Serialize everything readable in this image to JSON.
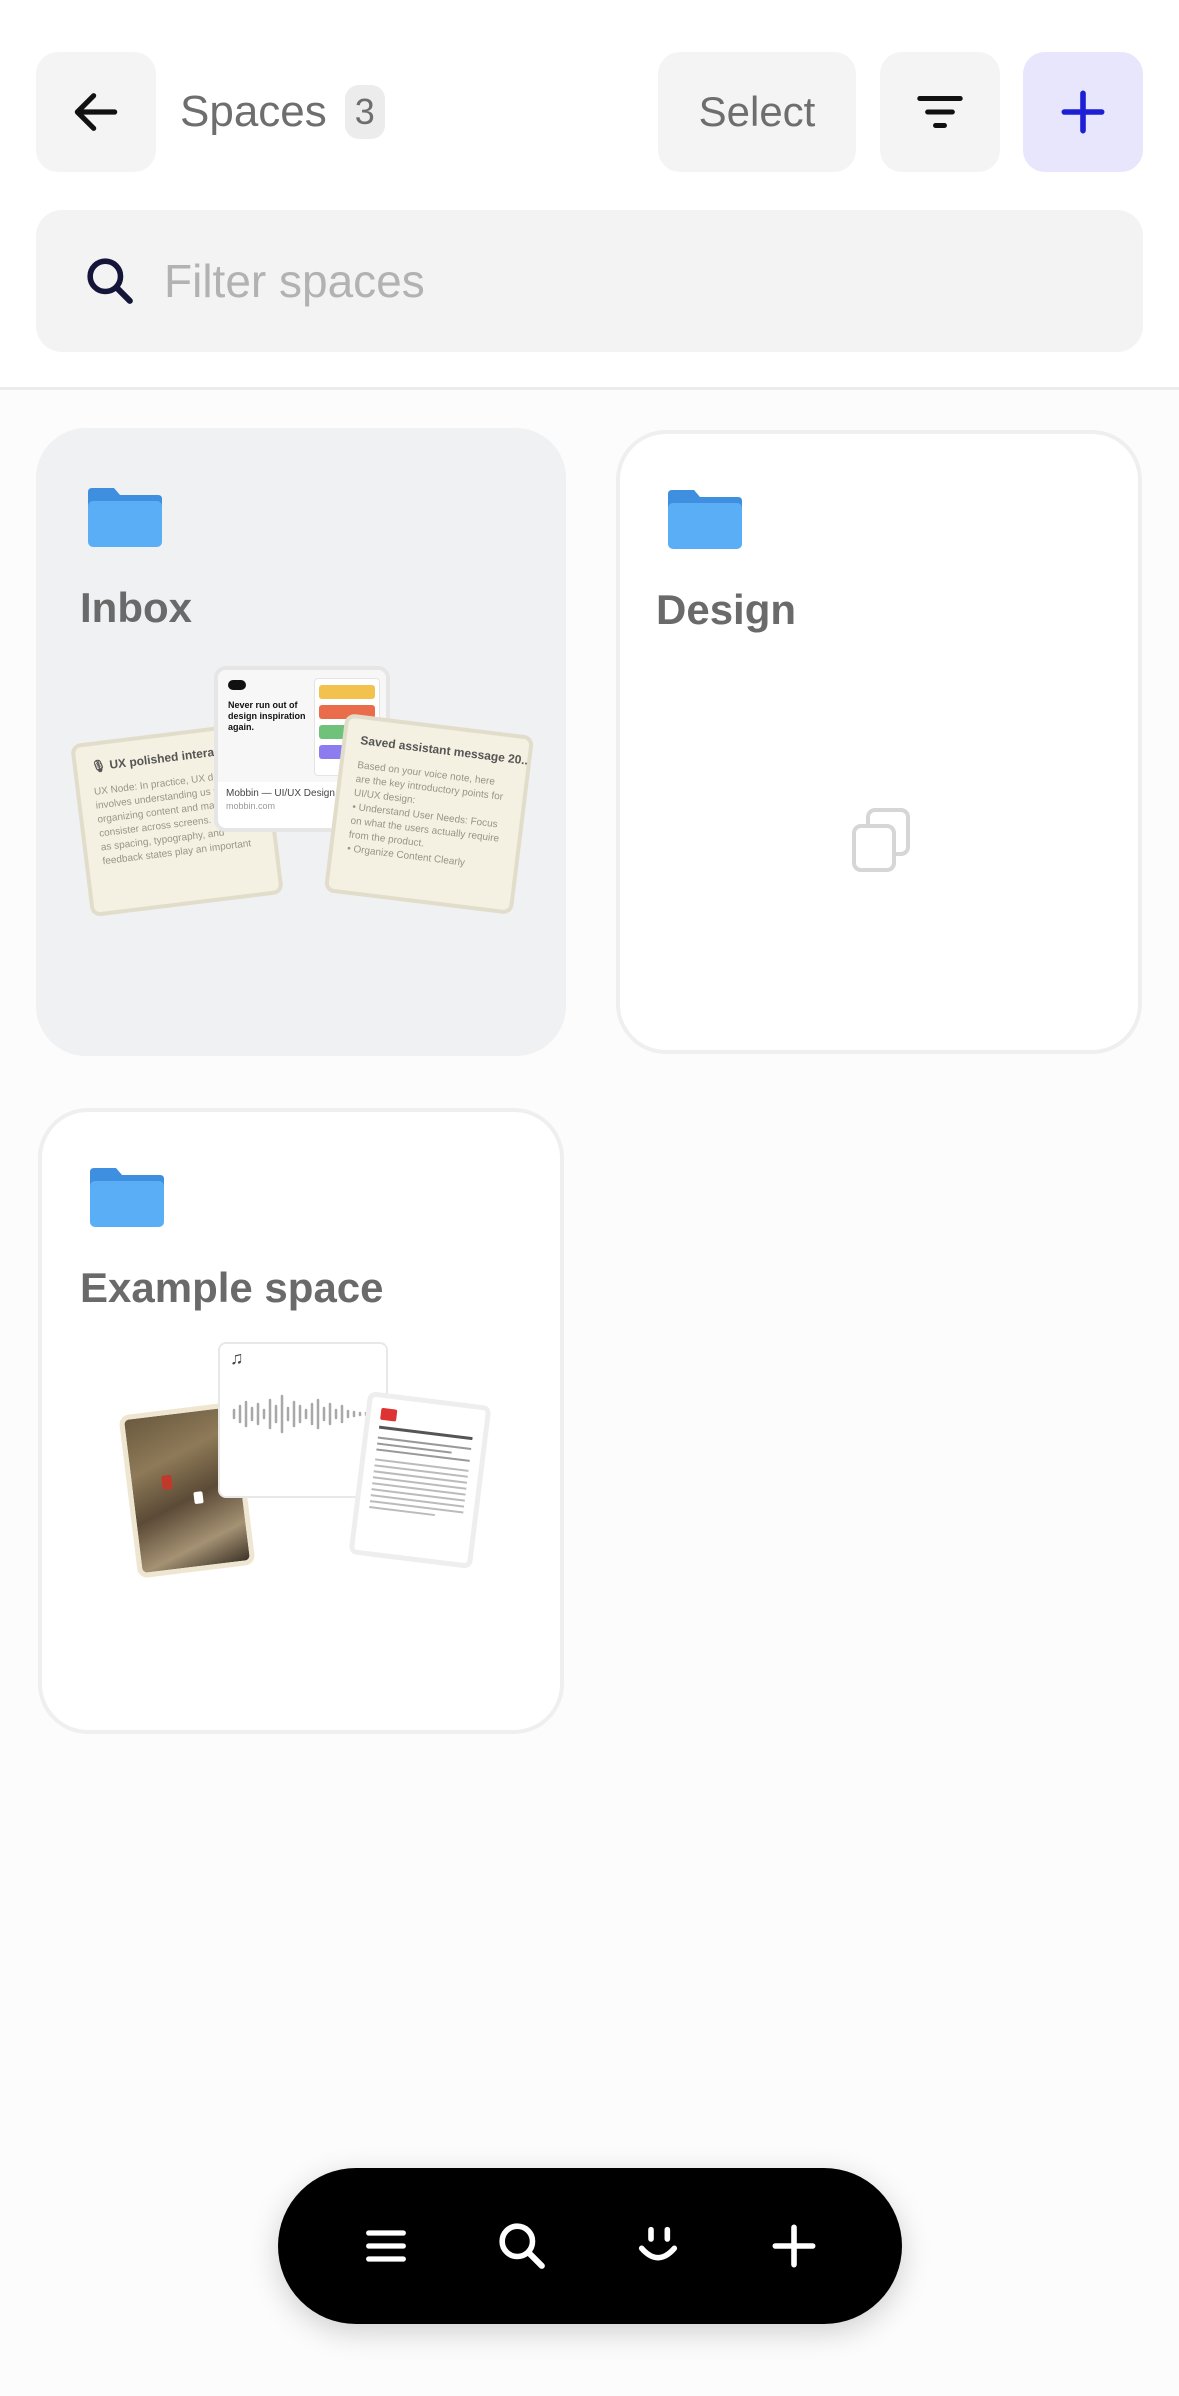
{
  "header": {
    "title": "Spaces",
    "count": "3",
    "select_label": "Select"
  },
  "search": {
    "placeholder": "Filter spaces"
  },
  "spaces": [
    {
      "title": "Inbox",
      "preview": {
        "note_left_title": "UX polished interactio",
        "note_left_body": "UX Node: In practice, UX d involves understanding us needs, organizing content and maintaining consister across screens. Small det as spacing, typography, and feedback states play an important",
        "link_card_headline": "Never run out of design inspiration again.",
        "link_card_title": "Mobbin — UI/UX Design",
        "link_card_url": "mobbin.com",
        "note_right_title": "Saved assistant message 20...",
        "note_right_body": "Based on your voice note, here are the key introductory points for UI/UX design:",
        "note_right_bullets": [
          "Understand User Needs: Focus on what the users actually require from the product.",
          "Organize Content Clearly"
        ]
      }
    },
    {
      "title": "Design",
      "preview": {
        "empty_icon": "copy-icon"
      }
    },
    {
      "title": "Example space",
      "preview": {
        "items": [
          "photo",
          "audio",
          "document"
        ]
      }
    }
  ],
  "bottom_nav": {
    "items": [
      "menu-icon",
      "search-icon",
      "smile-icon",
      "plus-icon"
    ]
  },
  "colors": {
    "accent": "#1d1fd6",
    "add_button_bg": "#e7e6fc",
    "folder": "#5aaef5"
  }
}
